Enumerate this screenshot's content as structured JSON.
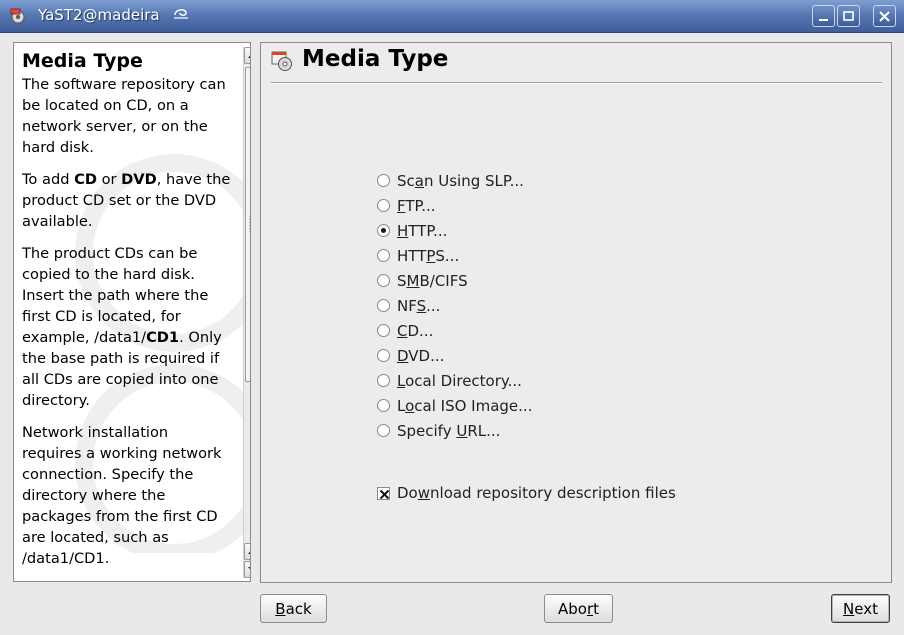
{
  "window": {
    "title": "YaST2@madeira"
  },
  "help": {
    "title": "Media Type",
    "para1": "The software repository can be located on CD, on a network server, or on the hard disk.",
    "para2": {
      "t1": "To add ",
      "b1": "CD",
      "t2": " or ",
      "b2": "DVD",
      "t3": ", have the product CD set or the DVD available."
    },
    "para3": {
      "t1": "The product CDs can be copied to the hard disk. Insert the path where the first CD is located, for example, /data1/",
      "b1": "CD1",
      "t2": ". Only the base path is required if all CDs are copied into one directory."
    },
    "para4": "Network installation requires a working network connection. Specify the directory where the packages from the first CD are located, such as /data1/CD1."
  },
  "main": {
    "title": "Media Type",
    "options": [
      {
        "pre": "Sc",
        "key": "a",
        "post": "n Using SLP...",
        "checked": false
      },
      {
        "pre": "",
        "key": "F",
        "post": "TP...",
        "checked": false
      },
      {
        "pre": "",
        "key": "H",
        "post": "TTP...",
        "checked": true
      },
      {
        "pre": "HTT",
        "key": "P",
        "post": "S...",
        "checked": false
      },
      {
        "pre": "S",
        "key": "M",
        "post": "B/CIFS",
        "checked": false
      },
      {
        "pre": "NF",
        "key": "S",
        "post": "...",
        "checked": false
      },
      {
        "pre": "",
        "key": "C",
        "post": "D...",
        "checked": false
      },
      {
        "pre": "",
        "key": "D",
        "post": "VD...",
        "checked": false
      },
      {
        "pre": "",
        "key": "L",
        "post": "ocal Directory...",
        "checked": false
      },
      {
        "pre": "L",
        "key": "o",
        "post": "cal ISO Image...",
        "checked": false
      },
      {
        "pre": "Specify ",
        "key": "U",
        "post": "RL...",
        "checked": false
      }
    ],
    "download": {
      "pre": "Do",
      "key": "w",
      "post": "nload repository description files",
      "checked": true
    }
  },
  "buttons": {
    "back": {
      "pre": "",
      "key": "B",
      "post": "ack"
    },
    "abort": {
      "pre": "Abo",
      "key": "r",
      "post": "t"
    },
    "next": {
      "pre": "",
      "key": "N",
      "post": "ext"
    }
  }
}
